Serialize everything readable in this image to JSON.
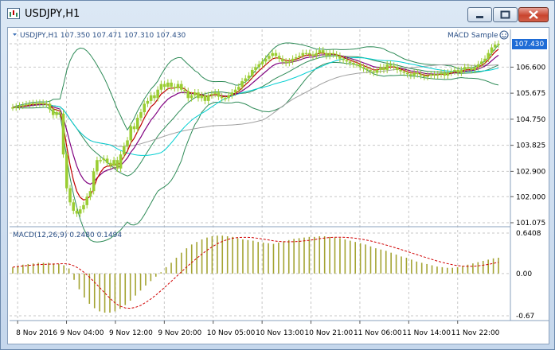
{
  "window": {
    "title": "USDJPY,H1"
  },
  "chart": {
    "header": "USDJPY,H1  107.350 107.471 107.310 107.430",
    "expert": "MACD Sample",
    "price_axis": [
      "101.075",
      "102.000",
      "102.900",
      "103.825",
      "104.750",
      "105.675",
      "106.600",
      "107.430"
    ],
    "current_price": "107.430",
    "time_axis": [
      "8 Nov 2016",
      "9 Nov 04:00",
      "9 Nov 12:00",
      "9 Nov 20:00",
      "10 Nov 05:00",
      "10 Nov 13:00",
      "10 Nov 21:00",
      "11 Nov 06:00",
      "11 Nov 14:00",
      "11 Nov 22:00"
    ],
    "indicator": {
      "label": "MACD(12,26,9) 0.2480 0.1494",
      "axis": [
        "0.6408",
        "0.00",
        "-0.67"
      ]
    }
  },
  "colors": {
    "candle": "#9acd32",
    "bollinger": "#2e8b57",
    "ma_fast": "#c00000",
    "ma_mid": "#800080",
    "ma_cyan": "#00ced1",
    "ma_slow": "#a0a0a0",
    "macd_hist": "#a4a432",
    "macd_signal": "#d00000",
    "price_tag_bg": "#1f6cd6"
  },
  "chart_data": [
    {
      "type": "candlestick",
      "symbol": "USDJPY",
      "timeframe": "H1",
      "close": [
        105.17,
        105.2,
        105.23,
        105.25,
        105.28,
        105.3,
        105.32,
        105.3,
        105.33,
        105.28,
        105.3,
        105.1,
        104.9,
        105.0,
        104.95,
        103.5,
        102.3,
        101.8,
        101.5,
        101.4,
        101.55,
        101.7,
        102.0,
        102.2,
        102.9,
        103.3,
        103.3,
        103.35,
        103.2,
        103.1,
        103.3,
        103.0,
        103.5,
        103.8,
        104.0,
        104.5,
        104.4,
        104.8,
        105.0,
        105.3,
        105.4,
        105.6,
        105.5,
        105.8,
        106.0,
        105.9,
        106.05,
        105.9,
        105.85,
        106.0,
        105.8,
        105.75,
        105.5,
        105.6,
        105.7,
        105.5,
        105.6,
        105.4,
        105.6,
        105.65,
        105.7,
        105.55,
        105.5,
        105.5,
        105.6,
        105.7,
        105.8,
        105.9,
        106.1,
        106.2,
        106.3,
        106.5,
        106.6,
        106.7,
        106.8,
        106.9,
        107.0,
        107.1,
        107.0,
        106.9,
        106.8,
        106.75,
        106.8,
        106.9,
        106.95,
        107.0,
        107.1,
        107.1,
        107.05,
        107.0,
        107.1,
        107.2,
        107.1,
        107.0,
        107.1,
        107.05,
        107.0,
        106.9,
        106.85,
        106.8,
        106.75,
        106.7,
        106.7,
        106.6,
        106.55,
        106.5,
        106.45,
        106.4,
        106.5,
        106.6,
        106.5,
        106.7,
        106.65,
        106.6,
        106.5,
        106.45,
        106.4,
        106.35,
        106.3,
        106.4,
        106.35,
        106.3,
        106.25,
        106.3,
        106.35,
        106.3,
        106.35,
        106.4,
        106.3,
        106.4,
        106.45,
        106.5,
        106.4,
        106.5,
        106.6,
        106.55,
        106.5,
        106.6,
        106.7,
        106.8,
        106.9,
        107.1,
        107.3,
        107.4,
        107.43
      ]
    },
    {
      "type": "bar",
      "name": "MACD",
      "values": [
        0.1,
        0.12,
        0.14,
        0.15,
        0.16,
        0.17,
        0.17,
        0.17,
        0.16,
        0.15,
        0.13,
        0.08,
        -0.1,
        -0.25,
        -0.38,
        -0.48,
        -0.55,
        -0.6,
        -0.62,
        -0.62,
        -0.6,
        -0.56,
        -0.5,
        -0.43,
        -0.35,
        -0.27,
        -0.19,
        -0.12,
        -0.05,
        0.02,
        0.1,
        0.17,
        0.25,
        0.33,
        0.4,
        0.46,
        0.5,
        0.54,
        0.57,
        0.59,
        0.6,
        0.6,
        0.59,
        0.58,
        0.56,
        0.54,
        0.53,
        0.52,
        0.5,
        0.49,
        0.48,
        0.47,
        0.49,
        0.51,
        0.53,
        0.55,
        0.56,
        0.57,
        0.58,
        0.58,
        0.59,
        0.59,
        0.58,
        0.57,
        0.56,
        0.54,
        0.52,
        0.5,
        0.48,
        0.46,
        0.43,
        0.4,
        0.38,
        0.36,
        0.33,
        0.3,
        0.27,
        0.25,
        0.22,
        0.19,
        0.17,
        0.15,
        0.13,
        0.11,
        0.1,
        0.09,
        0.09,
        0.1,
        0.12,
        0.14,
        0.16,
        0.18,
        0.2,
        0.22,
        0.24,
        0.25
      ]
    }
  ]
}
